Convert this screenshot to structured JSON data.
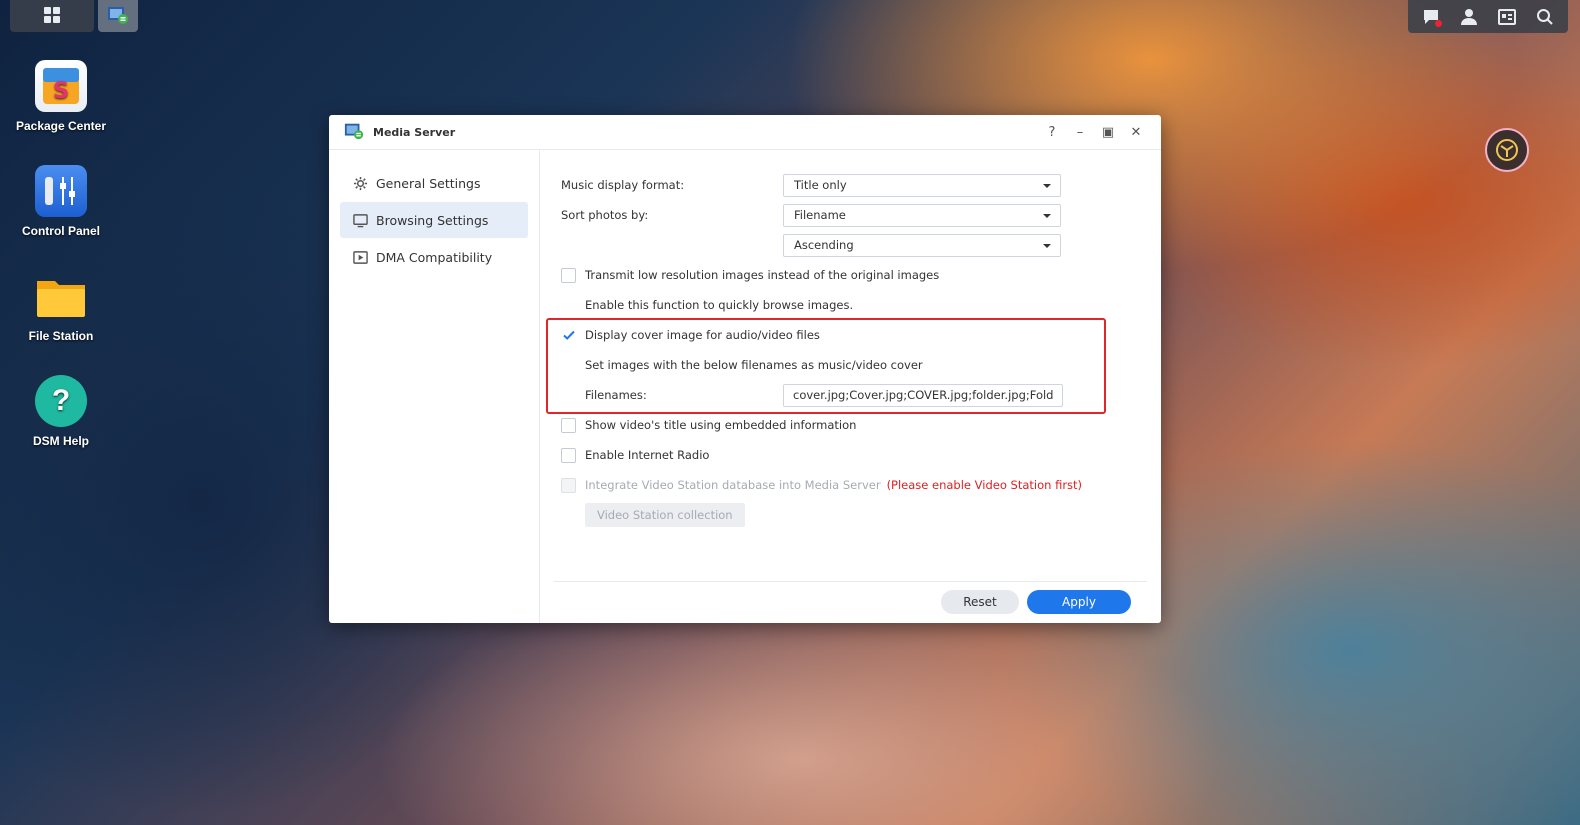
{
  "desktop": {
    "icons": [
      {
        "label": "Package Center"
      },
      {
        "label": "Control Panel"
      },
      {
        "label": "File Station"
      },
      {
        "label": "DSM Help"
      }
    ]
  },
  "window": {
    "title": "Media Server",
    "controls": {
      "help": "?",
      "minimize": "–",
      "maximize": "▣",
      "close": "✕"
    }
  },
  "sidebar": {
    "items": [
      {
        "label": "General Settings",
        "icon": "gear-icon"
      },
      {
        "label": "Browsing Settings",
        "icon": "monitor-icon",
        "active": true
      },
      {
        "label": "DMA Compatibility",
        "icon": "play-box-icon"
      }
    ]
  },
  "settings": {
    "music_format_label": "Music display format:",
    "music_format_value": "Title only",
    "sort_photos_label": "Sort photos by:",
    "sort_photos_value": "Filename",
    "sort_order_value": "Ascending",
    "low_res_label": "Transmit low resolution images instead of the original images",
    "low_res_checked": false,
    "low_res_hint": "Enable this function to quickly browse images.",
    "cover_label": "Display cover image for audio/video files",
    "cover_checked": true,
    "cover_hint": "Set images with the below filenames as music/video cover",
    "filenames_label": "Filenames:",
    "filenames_value": "cover.jpg;Cover.jpg;COVER.jpg;folder.jpg;Folder.jpg",
    "video_title_label": "Show video's title using embedded information",
    "video_title_checked": false,
    "internet_radio_label": "Enable Internet Radio",
    "internet_radio_checked": false,
    "integrate_label": "Integrate Video Station database into Media Server",
    "integrate_warning": "(Please enable Video Station first)",
    "collection_button": "Video Station collection"
  },
  "footer": {
    "reset": "Reset",
    "apply": "Apply"
  },
  "colors": {
    "accent": "#1e78ec",
    "highlight_border": "#e0262b",
    "warning": "#e02020"
  }
}
